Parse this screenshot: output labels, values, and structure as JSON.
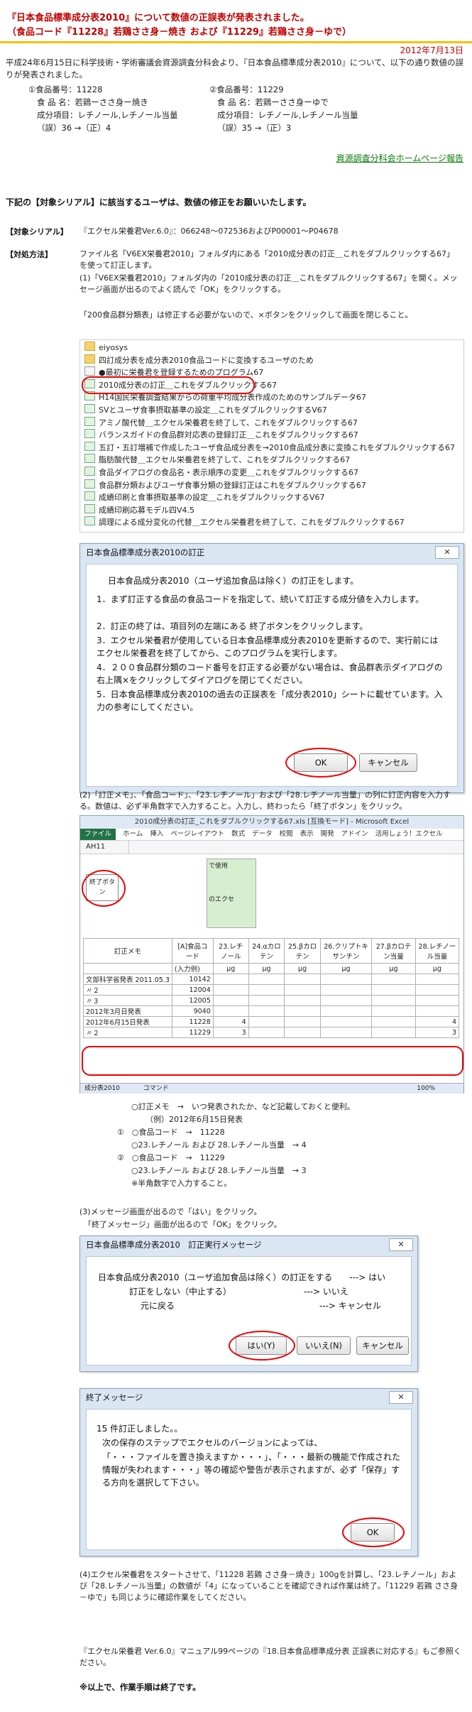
{
  "header": {
    "line1": "『日本食品標準成分表2010』について数値の正誤表が発表されました。",
    "line2": "（食品コード『11228』若鶏ささ身－焼き および『11229』若鶏ささ身－ゆで）"
  },
  "date": "2012年7月13日",
  "intro": "平成24年6月15日に科学技術・学術審議会資源調査分科会より、『日本食品標準成分表2010』について、以下の通り数値の誤りが発表されました。",
  "foods": [
    {
      "num": "①食品番号：11228",
      "name": "食 品 名：若鶏ーささ身ー焼き",
      "item": "成分項目：レチノール,レチノール当量",
      "fix": "（誤）36 →（正）4"
    },
    {
      "num": "②食品番号：11229",
      "name": "食 品 名：若鶏ーささ身ーゆで",
      "item": "成分項目：レチノール,レチノール当量",
      "fix": "（誤）35 →（正）3"
    }
  ],
  "hp_link": "資源調査分科会ホームページ報告",
  "notice": "下記の【対象シリアル】に該当するユーザは、数値の修正をお願いいたします。",
  "serial": {
    "label": "【対象シリアル】",
    "value": "『エクセル栄養君Ver.6.0』：066248～072536およびP00001～P04678"
  },
  "method": {
    "label": "【対処方法】",
    "p1": "ファイル名「V6EX栄養君2010」フォルダ内にある「2010成分表の訂正＿これをダブルクリックする67」を使って訂正します。",
    "p2": "(1)「V6EX栄養君2010」フォルダ内の「2010成分表の訂正＿これをダブルクリックする67」を開く。メッセージ画面が出るのでよく読んで「OK」をクリックする。",
    "p3": "「200食品群分類表」は修正する必要がないので、×ボタンをクリックして画面を閉じること。"
  },
  "explorer": {
    "items": [
      {
        "label": "eiyosys",
        "icon": "folder-icon"
      },
      {
        "label": "四訂成分表を成分表2010食品コードに変換するユーザのため",
        "icon": "folder-icon"
      },
      {
        "label": "●最初に栄養君を登録するためのプログラム67",
        "icon": "doc-icon"
      },
      {
        "label": "2010成分表の訂正＿これをダブルクリックする67",
        "icon": "excel-icon"
      },
      {
        "label": "H14国民栄養調査結果からの荷重平均成分表作成のためのサンプルデータ67",
        "icon": "excel-icon"
      },
      {
        "label": "SVとユーザ食事摂取基準の設定＿これをダブルクリックするV67",
        "icon": "excel-icon"
      },
      {
        "label": "アミノ酸代替＿エクセル栄養君を終了して、これをダブルクリックする67",
        "icon": "excel-icon"
      },
      {
        "label": "バランスガイドの食品群対応表の登録訂正＿これをダブルクリックする67",
        "icon": "excel-icon"
      },
      {
        "label": "五訂・五訂増補で作成したユーザ食品成分表を→2010食品成分表に変換これをダブルクリックする67",
        "icon": "excel-icon"
      },
      {
        "label": "脂肪酸代替＿エクセル栄養君を終了して、これをダブルクリックする67",
        "icon": "excel-icon"
      },
      {
        "label": "食品ダイアログの食品名・表示順序の変更＿これをダブルクリックする67",
        "icon": "excel-icon"
      },
      {
        "label": "食品群分類およびユーザ食事分類の登録訂正はこれをダブルクリックする67",
        "icon": "excel-icon"
      },
      {
        "label": "成績印刷と食事摂取基準の設定＿これをダブルクリックするV67",
        "icon": "excel-icon"
      },
      {
        "label": "成績印刷応募モデル四V4.5",
        "icon": "excel-icon"
      },
      {
        "label": "調理による成分変化の代替＿エクセル栄養君を終了して、これをダブルクリックする67",
        "icon": "excel-icon"
      }
    ]
  },
  "dialog1": {
    "title": "日本食品標準成分表2010の訂正",
    "close": "✕",
    "lines": [
      "日本食品成分表2010（ユーザ追加食品は除く）の訂正をします。",
      "1．まず訂正する食品の食品コードを指定して、続いて訂正する成分値を入力します。",
      "2．訂正の終了は、項目列の左端にある 終了ボタンをクリックします。",
      "3．エクセル栄養君が使用している日本食品標準成分表2010を更新するので、実行前にはエクセル栄養君を終了してから、このプログラムを実行します。",
      "4．２００食品群分類のコード番号を訂正する必要がない場合は、食品群表示ダイアログの右上隅×をクリックしてダイアログを閉じてください。",
      "5．日本食品標準成分表2010の過去の正誤表を「成分表2010」シートに載せています。入力の参考にしてください。"
    ],
    "ok": "OK",
    "cancel": "キャンセル"
  },
  "step2": "(2)「訂正メモ」、「食品コード」、「23.レチノール」および「28.レチノール当量」の列に訂正内容を入力する。数値は、必ず半角数字で入力すること。入力し、終わったら「終了ボタン」をクリック。",
  "excel": {
    "title": "2010成分表の訂正_これをダブルクリックする67.xls [互換モード] - Microsoft Excel",
    "tabs": [
      "ファイル",
      "ホーム",
      "挿入",
      "ページレイアウト",
      "数式",
      "データ",
      "校閲",
      "表示",
      "開発",
      "アドイン",
      "活用しょう！エクセル"
    ],
    "cell_ref": "AH11",
    "end_button": "終了ボタン",
    "side_label1": "で使用",
    "side_label2": "のエクセ",
    "headers": [
      "訂正メモ",
      "[A]食品コード",
      "23.レチノール",
      "24.αカロテン",
      "25.βカロテン",
      "26.クリプトキサンチン",
      "27.βカロテン当量",
      "28.レチノール当量"
    ],
    "subheader": "(入力例)",
    "units": "μg",
    "rows": [
      {
        "memo": "文部科学省発表 2011.05.3",
        "code": "10142",
        "v23": "",
        "v28": ""
      },
      {
        "memo": "〃２",
        "code": "12004",
        "v23": "",
        "v28": ""
      },
      {
        "memo": "〃３",
        "code": "12005",
        "v23": "",
        "v28": ""
      },
      {
        "memo": "2012年3月日発表",
        "code": "9040",
        "v23": "",
        "v28": ""
      },
      {
        "memo": "2012年6月15日発表",
        "code": "11228",
        "v23": "4",
        "v28": "4"
      },
      {
        "memo": "〃２",
        "code": "11229",
        "v23": "3",
        "v28": "3"
      }
    ],
    "sheet_tab": "成分表2010",
    "status_left": "コマンド",
    "zoom": "100%"
  },
  "notes": [
    "○訂正メモ　→　いつ発表されたか、など記載しておくと便利。",
    "（例）2012年6月15日発表",
    "①　○食品コード　→　11228",
    "○23.レチノール および 28.レチノール当量　→ 4",
    "②　○食品コード　→　11229",
    "○23.レチノール および 28.レチノール当量　→ 3",
    "※半角数字で入力すること。"
  ],
  "step3": [
    "(3)メッセージ画面が出るので「はい」をクリック。",
    "「終了メッセージ」画面が出るので「OK」をクリック。"
  ],
  "dialog2": {
    "title": "日本食品標準成分表2010　訂正実行メッセージ",
    "close": "✕",
    "lines": [
      "日本食品成分表2010（ユーザ追加食品は除く）の訂正をする　　---> はい",
      "訂正をしない（中止する）　　　　　　　　　---> いいえ",
      "元に戻る　　　　　　　　　　　　　　　　　---> キャンセル"
    ],
    "yes": "はい(Y)",
    "no": "いいえ(N)",
    "cancel": "キャンセル"
  },
  "dialog3": {
    "title": "終了メッセージ",
    "close": "✕",
    "lines": [
      "15 件訂正しました。。",
      "次の保存のステップでエクセルのバージョンによっては、",
      "「・・・ファイルを置き換えますか・・・」、「・・・最新の機能で作成された情報が失われます・・・」等の確認や警告が表示されますが、必ず「保存」する方向を選択して下さい。"
    ],
    "ok": "OK"
  },
  "step4": "(4)エクセル栄養君をスタートさせて、「11228 若鶏 ささ身－焼き」100gを計算し、「23.レチノール」および「28.レチノール当量」の数値が「4」になっていることを確認できれば作業は終了。「11229 若鶏 ささ身－ゆで」も同じように確認作業をしてください。",
  "manual": "『エクセル栄養君 Ver.6.0』マニュアル99ページの『18.日本食品標準成分表 正誤表に対応する』もご参照ください。",
  "finish": "※以上で、作業手順は終了です。"
}
